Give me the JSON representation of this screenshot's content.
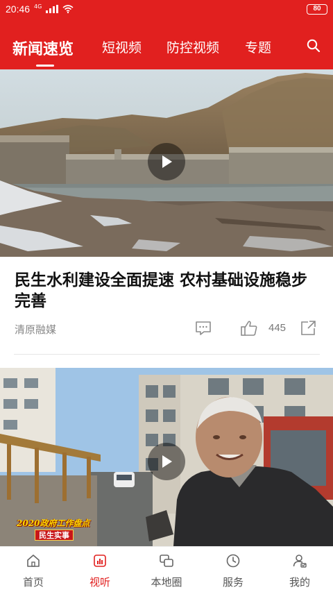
{
  "status_bar": {
    "time": "20:46",
    "network": "4G",
    "battery": "80"
  },
  "tabs": [
    {
      "label": "新闻速览",
      "active": true
    },
    {
      "label": "短视频",
      "active": false
    },
    {
      "label": "防控视频",
      "active": false
    },
    {
      "label": "专题",
      "active": false
    }
  ],
  "icons": {
    "search": "search-icon",
    "play": "play-icon",
    "comment": "comment-icon",
    "like": "thumbs-up-icon",
    "share": "share-icon",
    "home": "home-icon",
    "video": "bar-chart-icon",
    "local": "chat-bubbles-icon",
    "service": "clock-icon",
    "mine": "user-icon"
  },
  "articles": [
    {
      "title": "民生水利建设全面提速  农村基础设施稳步完善",
      "source": "清原融媒",
      "likes": "445"
    },
    {
      "overlay_line1": "2020政府工作盘点",
      "overlay_line2": "民生实事"
    }
  ],
  "bottom_nav": [
    {
      "label": "首页",
      "active": false
    },
    {
      "label": "视听",
      "active": true
    },
    {
      "label": "本地圈",
      "active": false
    },
    {
      "label": "服务",
      "active": false
    },
    {
      "label": "我的",
      "active": false
    }
  ],
  "colors": {
    "brand": "#e1201f",
    "text": "#111111",
    "muted": "#888888"
  }
}
